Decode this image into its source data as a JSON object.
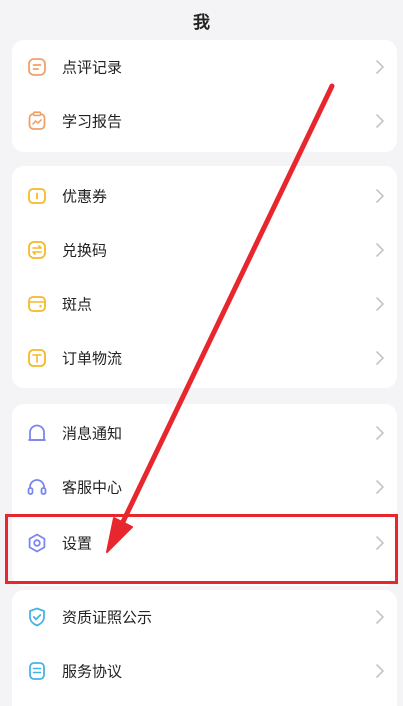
{
  "header": {
    "title": "我"
  },
  "sections": [
    {
      "items": [
        {
          "label": "点评记录",
          "icon": "comment-note-icon",
          "color": "#f0a069"
        },
        {
          "label": "学习报告",
          "icon": "report-icon",
          "color": "#f0a069"
        }
      ]
    },
    {
      "items": [
        {
          "label": "优惠券",
          "icon": "coupon-icon",
          "color": "#f5b829"
        },
        {
          "label": "兑换码",
          "icon": "exchange-code-icon",
          "color": "#f5b829"
        },
        {
          "label": "斑点",
          "icon": "wallet-icon",
          "color": "#f5b829"
        },
        {
          "label": "订单物流",
          "icon": "order-box-icon",
          "color": "#f5b829"
        }
      ]
    },
    {
      "items": [
        {
          "label": "消息通知",
          "icon": "bell-icon",
          "color": "#7b86f0"
        },
        {
          "label": "客服中心",
          "icon": "headset-icon",
          "color": "#7b86f0"
        },
        {
          "label": "设置",
          "icon": "settings-hexagon-icon",
          "color": "#7b86f0"
        }
      ]
    },
    {
      "items": [
        {
          "label": "资质证照公示",
          "icon": "shield-check-icon",
          "color": "#45b3e6"
        },
        {
          "label": "服务协议",
          "icon": "agreement-icon",
          "color": "#45b3e6"
        }
      ]
    }
  ],
  "annotation": {
    "highlight_color": "#e8262e"
  }
}
